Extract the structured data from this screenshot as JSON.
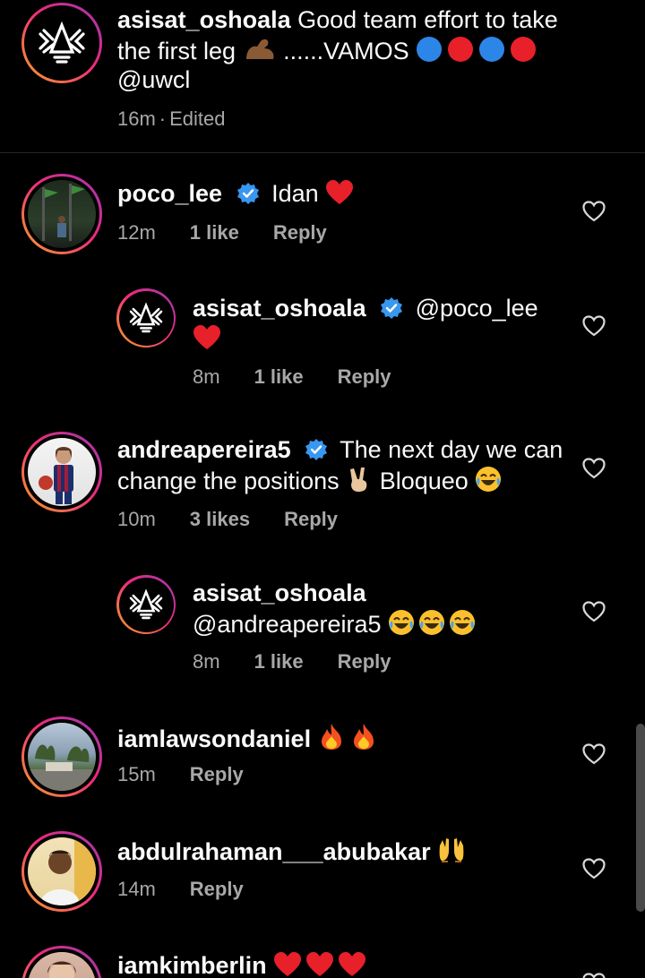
{
  "caption": {
    "username": "asisat_oshoala",
    "text_line1": "Good team effort to take",
    "text_line2_a": "the first leg",
    "text_line2_b": "......VAMOS",
    "text_line3": "@uwcl",
    "time": "16m",
    "edited": "Edited",
    "separator": "·"
  },
  "comments": [
    {
      "username": "poco_lee",
      "text": "Idan",
      "time": "12m",
      "likes": "1 like",
      "reply": "Reply"
    },
    {
      "username": "asisat_oshoala",
      "mention": "@poco_lee",
      "time": "8m",
      "likes": "1 like",
      "reply": "Reply"
    },
    {
      "username": "andreapereira5",
      "text_a": "The next day we can",
      "text_b": "change the positions",
      "text_c": "Bloqueo",
      "time": "10m",
      "likes": "3 likes",
      "reply": "Reply"
    },
    {
      "username": "asisat_oshoala",
      "mention": "@andreapereira5",
      "time": "8m",
      "likes": "1 like",
      "reply": "Reply"
    },
    {
      "username": "iamlawsondaniel",
      "time": "15m",
      "reply": "Reply"
    },
    {
      "username": "abdulrahaman___abubakar",
      "time": "14m",
      "reply": "Reply"
    },
    {
      "username": "iamkimberlin"
    }
  ],
  "colors": {
    "background": "#000000",
    "text": "#fafafa",
    "meta": "#a8a8a8",
    "verified": "#3897f0",
    "heart_red": "#e8202a"
  },
  "icons": [
    "logo-avatar",
    "verified-badge-icon",
    "heart-outline-icon",
    "red-heart-emoji",
    "fire-emoji",
    "laughing-emoji",
    "raised-hands-emoji",
    "victory-hand-emoji",
    "flexed-bicep-emoji",
    "blue-circle-emoji",
    "red-circle-emoji"
  ]
}
